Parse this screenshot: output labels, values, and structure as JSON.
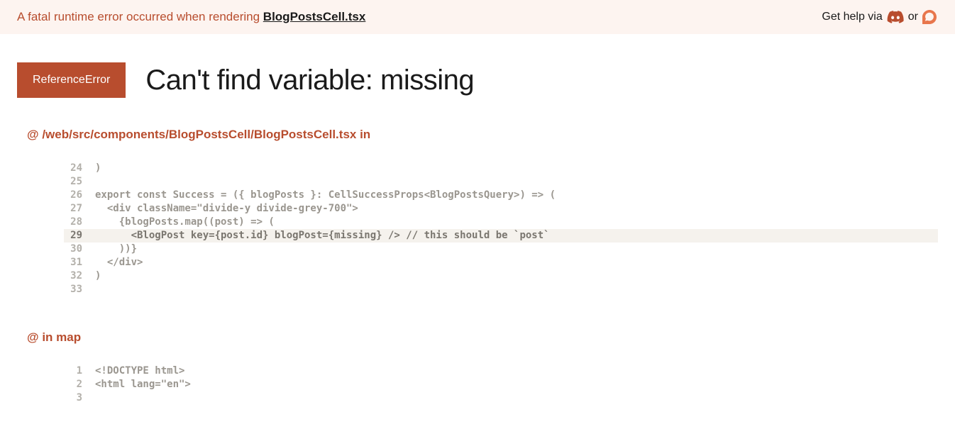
{
  "header": {
    "error_prefix": "A fatal runtime error occurred when rendering ",
    "filename": "BlogPostsCell.tsx",
    "help_prefix": "Get help via ",
    "help_or": " or "
  },
  "error": {
    "type": "ReferenceError",
    "message": "Can't find variable: missing"
  },
  "stacks": [
    {
      "at": "@ ",
      "location": "/web/src/components/BlogPostsCell/BlogPostsCell.tsx",
      "suffix": " in",
      "lines": [
        {
          "num": "24",
          "code": ")",
          "highlight": false
        },
        {
          "num": "25",
          "code": "",
          "highlight": false
        },
        {
          "num": "26",
          "code": "export const Success = ({ blogPosts }: CellSuccessProps<BlogPostsQuery>) => (",
          "highlight": false
        },
        {
          "num": "27",
          "code": "  <div className=\"divide-y divide-grey-700\">",
          "highlight": false
        },
        {
          "num": "28",
          "code": "    {blogPosts.map((post) => (",
          "highlight": false
        },
        {
          "num": "29",
          "code": "      <BlogPost key={post.id} blogPost={missing} /> // this should be `post`",
          "highlight": true
        },
        {
          "num": "30",
          "code": "    ))}",
          "highlight": false
        },
        {
          "num": "31",
          "code": "  </div>",
          "highlight": false
        },
        {
          "num": "32",
          "code": ")",
          "highlight": false
        },
        {
          "num": "33",
          "code": "",
          "highlight": false
        }
      ]
    },
    {
      "at": "@ ",
      "location": "",
      "suffix": " in map",
      "lines": [
        {
          "num": "1",
          "code": "<!DOCTYPE html>",
          "highlight": false
        },
        {
          "num": "2",
          "code": "<html lang=\"en\">",
          "highlight": false
        },
        {
          "num": "3",
          "code": "",
          "highlight": false
        }
      ]
    }
  ]
}
